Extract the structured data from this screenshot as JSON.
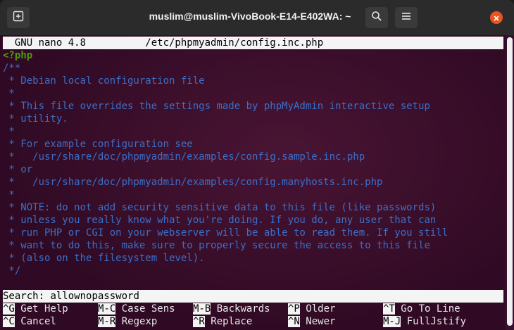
{
  "window": {
    "title": "muslim@muslim-VivoBook-E14-E402WA: ~"
  },
  "titlebar_icons": {
    "new_tab": "new-tab-icon",
    "search": "search-icon",
    "menu": "hamburger-menu-icon",
    "close": "close-icon"
  },
  "nano": {
    "header": "  GNU nano 4.8          /etc/phpmyadmin/config.inc.php",
    "lines": [
      {
        "text": "<?php",
        "kind": "php"
      },
      {
        "text": "/**",
        "kind": "comment"
      },
      {
        "text": " * Debian local configuration file",
        "kind": "comment"
      },
      {
        "text": " *",
        "kind": "comment"
      },
      {
        "text": " * This file overrides the settings made by phpMyAdmin interactive setup",
        "kind": "comment"
      },
      {
        "text": " * utility.",
        "kind": "comment"
      },
      {
        "text": " *",
        "kind": "comment"
      },
      {
        "text": " * For example configuration see",
        "kind": "comment"
      },
      {
        "text": " *   /usr/share/doc/phpmyadmin/examples/config.sample.inc.php",
        "kind": "comment"
      },
      {
        "text": " * or",
        "kind": "comment"
      },
      {
        "text": " *   /usr/share/doc/phpmyadmin/examples/config.manyhosts.inc.php",
        "kind": "comment"
      },
      {
        "text": " *",
        "kind": "comment"
      },
      {
        "text": " * NOTE: do not add security sensitive data to this file (like passwords)",
        "kind": "comment"
      },
      {
        "text": " * unless you really know what you're doing. If you do, any user that can",
        "kind": "comment"
      },
      {
        "text": " * run PHP or CGI on your webserver will be able to read them. If you still",
        "kind": "comment"
      },
      {
        "text": " * want to do this, make sure to properly secure the access to this file",
        "kind": "comment"
      },
      {
        "text": " * (also on the filesystem level).",
        "kind": "comment"
      },
      {
        "text": " */",
        "kind": "comment"
      }
    ],
    "search_label": "Search: ",
    "search_value": "allownopassword",
    "shortcuts_row1": [
      {
        "key": "^G",
        "label": " Get Help"
      },
      {
        "key": "M-C",
        "label": " Case Sens"
      },
      {
        "key": "M-B",
        "label": " Backwards"
      },
      {
        "key": "^P",
        "label": " Older"
      },
      {
        "key": "^T",
        "label": " Go To Line"
      }
    ],
    "shortcuts_row2": [
      {
        "key": "^C",
        "label": " Cancel"
      },
      {
        "key": "M-R",
        "label": " Regexp"
      },
      {
        "key": "^R",
        "label": " Replace"
      },
      {
        "key": "^N",
        "label": " Newer"
      },
      {
        "key": "M-J",
        "label": " FullJstify"
      }
    ]
  },
  "colors": {
    "terminal_bg": "#300a24",
    "comment": "#3b6fc8",
    "php_tag": "#4e9a06",
    "close_button": "#e95420"
  }
}
